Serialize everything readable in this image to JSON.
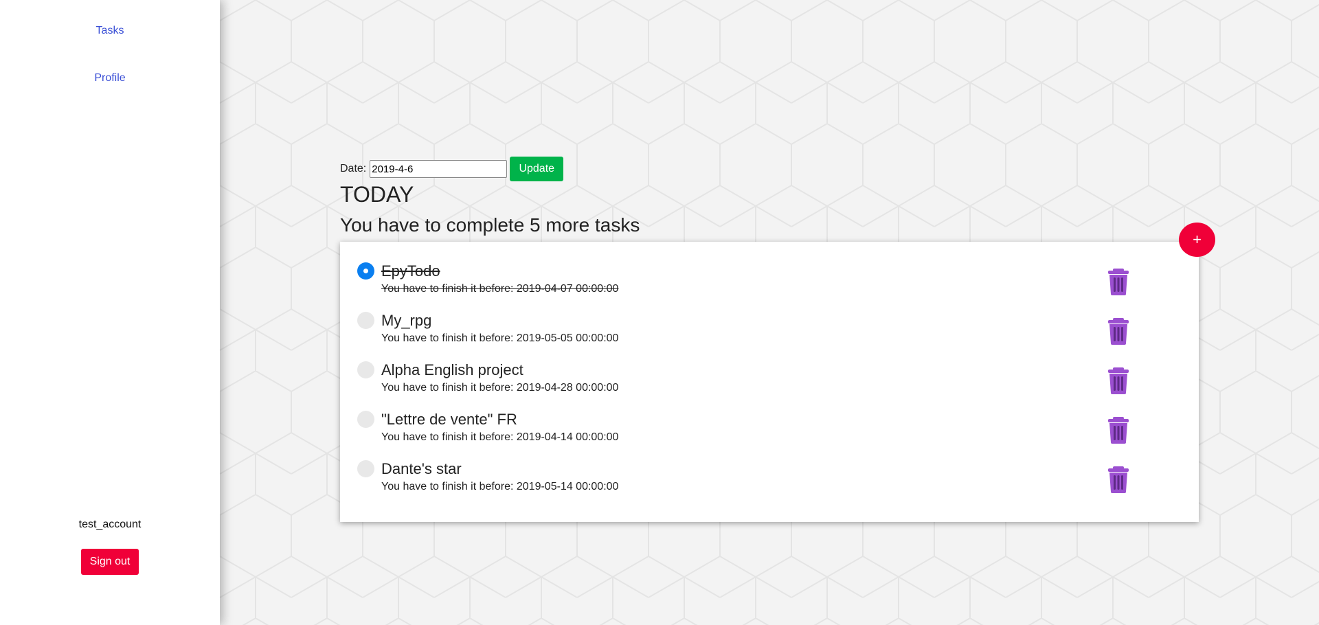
{
  "sidebar": {
    "nav": [
      {
        "label": "Tasks"
      },
      {
        "label": "Profile"
      }
    ],
    "account": {
      "username": "test_account",
      "signout_label": "Sign out"
    }
  },
  "main": {
    "date_label": "Date:",
    "date_value": "2019-4-6",
    "update_label": "Update",
    "day_title": "TODAY",
    "summary": "You have to complete 5 more tasks",
    "add_label": "+",
    "tasks": [
      {
        "title": "EpyTodo",
        "deadline": "You have to finish it before: 2019-04-07 00:00:00",
        "done": true
      },
      {
        "title": "My_rpg",
        "deadline": "You have to finish it before: 2019-05-05 00:00:00",
        "done": false
      },
      {
        "title": "Alpha English project",
        "deadline": "You have to finish it before: 2019-04-28 00:00:00",
        "done": false
      },
      {
        "title": "\"Lettre de vente\" FR",
        "deadline": "You have to finish it before: 2019-04-14 00:00:00",
        "done": false
      },
      {
        "title": "Dante's star",
        "deadline": "You have to finish it before: 2019-05-14 00:00:00",
        "done": false
      }
    ]
  },
  "colors": {
    "accent_red": "#f00038",
    "update_green": "#00b34a",
    "radio_blue": "#0a7ff0",
    "trash_purple": "#9b4fd0",
    "link_blue": "#3a4fd6"
  },
  "icons": {
    "trash": "trash-icon",
    "add": "plus-icon"
  }
}
